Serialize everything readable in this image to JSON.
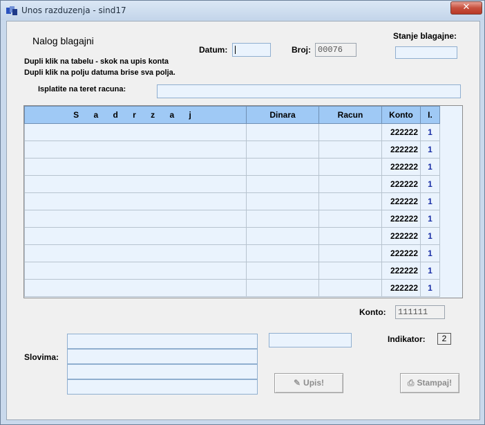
{
  "window": {
    "title": "Unos razduzenja - sind17",
    "close_glyph": "✕"
  },
  "form": {
    "heading": "Nalog blagajni",
    "hint_1": "Dupli klik na tabelu - skok na upis konta",
    "hint_2": "Dupli klik na polju datuma brise sva polja.",
    "datum_label": "Datum:",
    "datum_value": "",
    "broj_label": "Broj:",
    "broj_value": "00076",
    "stanje_label": "Stanje blagajne:",
    "stanje_value": "",
    "isplatite_label": "Isplatite na teret racuna:",
    "isplatite_value": ""
  },
  "table": {
    "columns": [
      "S a d r z a j",
      "Dinara",
      "Racun",
      "Konto",
      "I."
    ],
    "rows": [
      {
        "sadrzaj": "",
        "dinara": "",
        "racun": "",
        "konto": "222222",
        "ind": "1"
      },
      {
        "sadrzaj": "",
        "dinara": "",
        "racun": "",
        "konto": "222222",
        "ind": "1"
      },
      {
        "sadrzaj": "",
        "dinara": "",
        "racun": "",
        "konto": "222222",
        "ind": "1"
      },
      {
        "sadrzaj": "",
        "dinara": "",
        "racun": "",
        "konto": "222222",
        "ind": "1"
      },
      {
        "sadrzaj": "",
        "dinara": "",
        "racun": "",
        "konto": "222222",
        "ind": "1"
      },
      {
        "sadrzaj": "",
        "dinara": "",
        "racun": "",
        "konto": "222222",
        "ind": "1"
      },
      {
        "sadrzaj": "",
        "dinara": "",
        "racun": "",
        "konto": "222222",
        "ind": "1"
      },
      {
        "sadrzaj": "",
        "dinara": "",
        "racun": "",
        "konto": "222222",
        "ind": "1"
      },
      {
        "sadrzaj": "",
        "dinara": "",
        "racun": "",
        "konto": "222222",
        "ind": "1"
      },
      {
        "sadrzaj": "",
        "dinara": "",
        "racun": "",
        "konto": "222222",
        "ind": "1"
      }
    ]
  },
  "footer": {
    "konto_label": "Konto:",
    "konto_value": "111111",
    "slovima_label": "Slovima:",
    "slovima_lines": [
      "",
      "",
      "",
      ""
    ],
    "amount_value": "",
    "indikator_label": "Indikator:",
    "indikator_value": "2",
    "upis_label": "Upis!",
    "stampaj_label": "Stampaj!"
  },
  "colors": {
    "field_bg": "#eaf3fd",
    "header_bg": "#9fc9f5",
    "indicator_text": "#1a2fa6"
  },
  "icons": {
    "app": "app-icon",
    "upis": "pen-icon",
    "stampaj": "printer-icon"
  }
}
